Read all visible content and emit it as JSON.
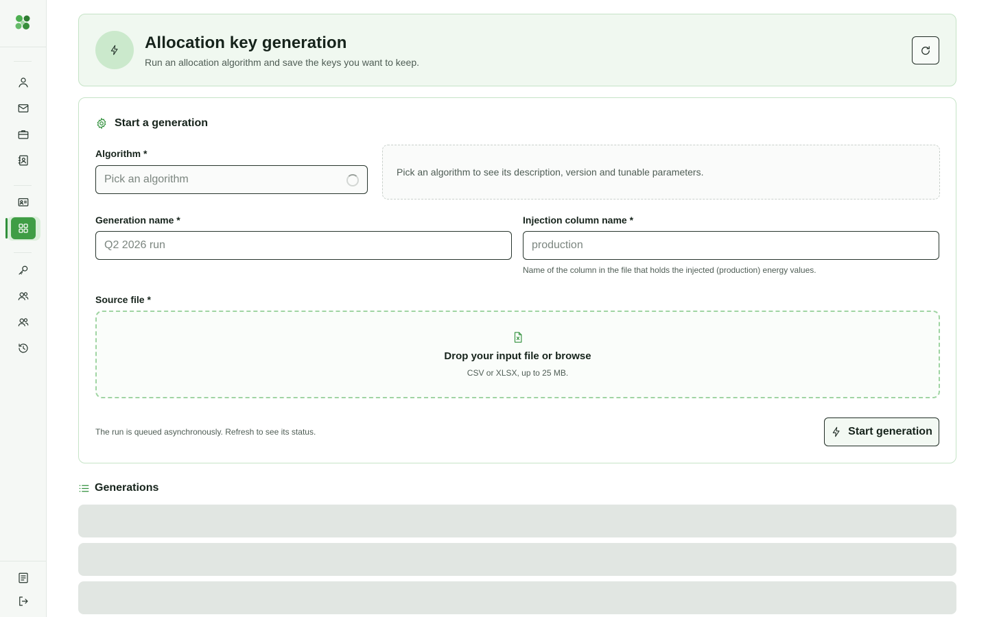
{
  "sidebar": {
    "logo": "clover-logo-icon",
    "items": [
      {
        "icon": "user-icon"
      },
      {
        "icon": "mail-icon"
      },
      {
        "icon": "briefcase-icon"
      },
      {
        "icon": "contact-book-icon"
      },
      {
        "icon": "id-card-icon"
      },
      {
        "icon": "grid-icon",
        "active": true
      },
      {
        "icon": "key-icon"
      },
      {
        "icon": "users-icon"
      },
      {
        "icon": "users-icon"
      },
      {
        "icon": "history-icon"
      }
    ],
    "bottom": [
      {
        "icon": "document-icon"
      },
      {
        "icon": "logout-icon"
      }
    ]
  },
  "header": {
    "icon": "lightning-icon",
    "title": "Allocation key generation",
    "subtitle": "Run an allocation algorithm and save the keys you want to keep.",
    "refresh_icon": "refresh-icon"
  },
  "form": {
    "section_title": "Start a generation",
    "section_icon": "gear-icon",
    "algorithm": {
      "label": "Algorithm *",
      "placeholder": "Pick an algorithm",
      "info": "Pick an algorithm to see its description, version and tunable parameters."
    },
    "generation_name": {
      "label": "Generation name *",
      "placeholder": "Q2 2026 run",
      "value": ""
    },
    "injection_column": {
      "label": "Injection column name *",
      "placeholder": "production",
      "value": "",
      "help": "Name of the column in the file that holds the injected (production) energy values."
    },
    "source_file": {
      "label": "Source file *",
      "icon": "spreadsheet-file-icon",
      "title": "Drop your input file or browse",
      "subtitle": "CSV or XLSX, up to 25 MB."
    },
    "footer_note": "The run is queued asynchronously. Refresh to see its status.",
    "submit_label": "Start generation",
    "submit_icon": "lightning-icon"
  },
  "generations": {
    "title": "Generations",
    "icon": "list-icon",
    "loading_rows": 3
  },
  "colors": {
    "accent": "#3f9d45",
    "accent_light": "#cbe9cc",
    "border": "#c5e3c6",
    "skeleton": "#e1e6e2"
  }
}
